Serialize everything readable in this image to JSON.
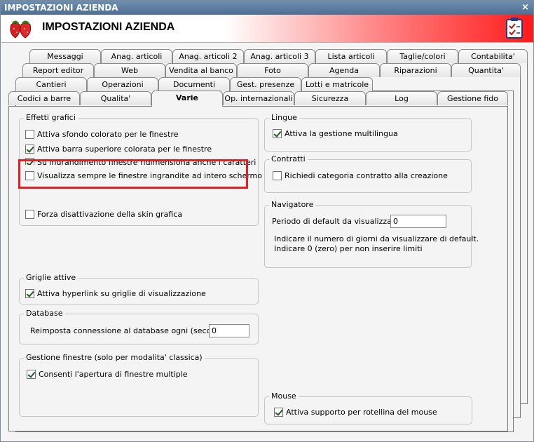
{
  "window": {
    "title": "IMPOSTAZIONI AZIENDA",
    "close": "×"
  },
  "header": {
    "title": "IMPOSTAZIONI AZIENDA"
  },
  "tabs": {
    "row1": [
      "Messaggi",
      "Anag. articoli",
      "Anag. articoli 2",
      "Anag. articoli 3",
      "Lista articoli",
      "Taglie/colori",
      "Contabilita'"
    ],
    "row2": [
      "Report editor",
      "Web",
      "Vendita al banco",
      "Foto",
      "Agenda",
      "Riparazioni",
      "Quantita'"
    ],
    "row3": [
      "Cantieri",
      "Operazioni",
      "Documenti",
      "Gest. presenze",
      "Lotti e matricole"
    ],
    "row4": [
      "Codici a barre",
      "Qualita'",
      "Varie",
      "Op. internazionali",
      "Sicurezza",
      "Log",
      "Gestione fido"
    ]
  },
  "effetti": {
    "label": "Effetti grafici",
    "items": [
      {
        "label": "Attiva sfondo colorato per le finestre",
        "checked": false
      },
      {
        "label": "Attiva barra superiore colorata per le finestre",
        "checked": true
      },
      {
        "label": "Su ingrandimento finestre ridimensiona anche i caratteri",
        "checked": true
      },
      {
        "label": "Visualizza sempre le finestre ingrandite ad intero schermo",
        "checked": false
      },
      {
        "label": "Forza disattivazione della skin grafica",
        "checked": false
      }
    ]
  },
  "griglie": {
    "label": "Griglie attive",
    "item": "Attiva hyperlink su griglie di visualizzazione",
    "checked": true
  },
  "database": {
    "label": "Database",
    "text": "Reimposta connessione al database ogni (secondi) :",
    "value": "0"
  },
  "gestione": {
    "label": "Gestione finestre (solo per modalita' classica)",
    "item": "Consenti l'apertura di finestre multiple",
    "checked": true
  },
  "lingue": {
    "label": "Lingue",
    "item": "Attiva la gestione multilingua",
    "checked": true
  },
  "contratti": {
    "label": "Contratti",
    "item": "Richiedi categoria contratto alla creazione",
    "checked": false
  },
  "navigatore": {
    "label": "Navigatore",
    "field_label": "Periodo di default da visualizzare :",
    "value": "0",
    "note1": "Indicare il numero di giorni da visualizzare di default.",
    "note2": "Indicare 0 (zero) per non inserire limiti"
  },
  "mouse": {
    "label": "Mouse",
    "item": "Attiva supporto per rotellina del mouse",
    "checked": true
  }
}
